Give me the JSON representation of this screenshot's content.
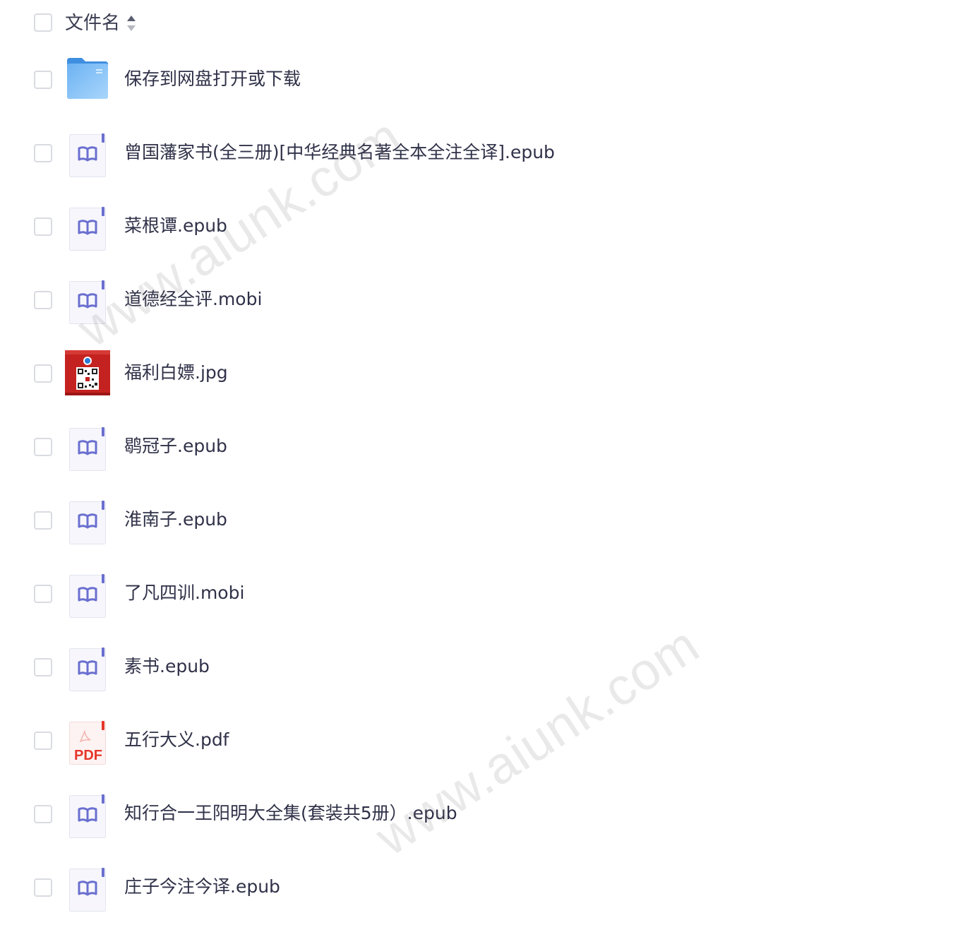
{
  "header": {
    "title": "文件名",
    "sort_icon": "sort-updown-icon"
  },
  "files": [
    {
      "name": "保存到网盘打开或下载",
      "type": "folder",
      "icon": "folder-icon"
    },
    {
      "name": "曾国藩家书(全三册)[中华经典名著全本全注全译].epub",
      "type": "ebook",
      "icon": "ebook-icon"
    },
    {
      "name": "菜根谭.epub",
      "type": "ebook",
      "icon": "ebook-icon"
    },
    {
      "name": "道德经全评.mobi",
      "type": "ebook",
      "icon": "ebook-icon"
    },
    {
      "name": "福利白嫖.jpg",
      "type": "image",
      "icon": "image-thumbnail"
    },
    {
      "name": "鹖冠子.epub",
      "type": "ebook",
      "icon": "ebook-icon"
    },
    {
      "name": "淮南子.epub",
      "type": "ebook",
      "icon": "ebook-icon"
    },
    {
      "name": "了凡四训.mobi",
      "type": "ebook",
      "icon": "ebook-icon"
    },
    {
      "name": "素书.epub",
      "type": "ebook",
      "icon": "ebook-icon"
    },
    {
      "name": "五行大义.pdf",
      "type": "pdf",
      "icon": "pdf-icon",
      "icon_text": "PDF"
    },
    {
      "name": "知行合一王阳明大全集(套装共5册）.epub",
      "type": "ebook",
      "icon": "ebook-icon"
    },
    {
      "name": "庄子今注今译.epub",
      "type": "ebook",
      "icon": "ebook-icon"
    }
  ],
  "watermarks": [
    "www.aiunk.com",
    "www.aiunk.com"
  ],
  "colors": {
    "checkbox_border": "#d9dbe1",
    "text": "#2f3148",
    "folder": "#5aa8f2",
    "ebook_accent": "#6a6fcf",
    "pdf_red": "#e6362b"
  }
}
